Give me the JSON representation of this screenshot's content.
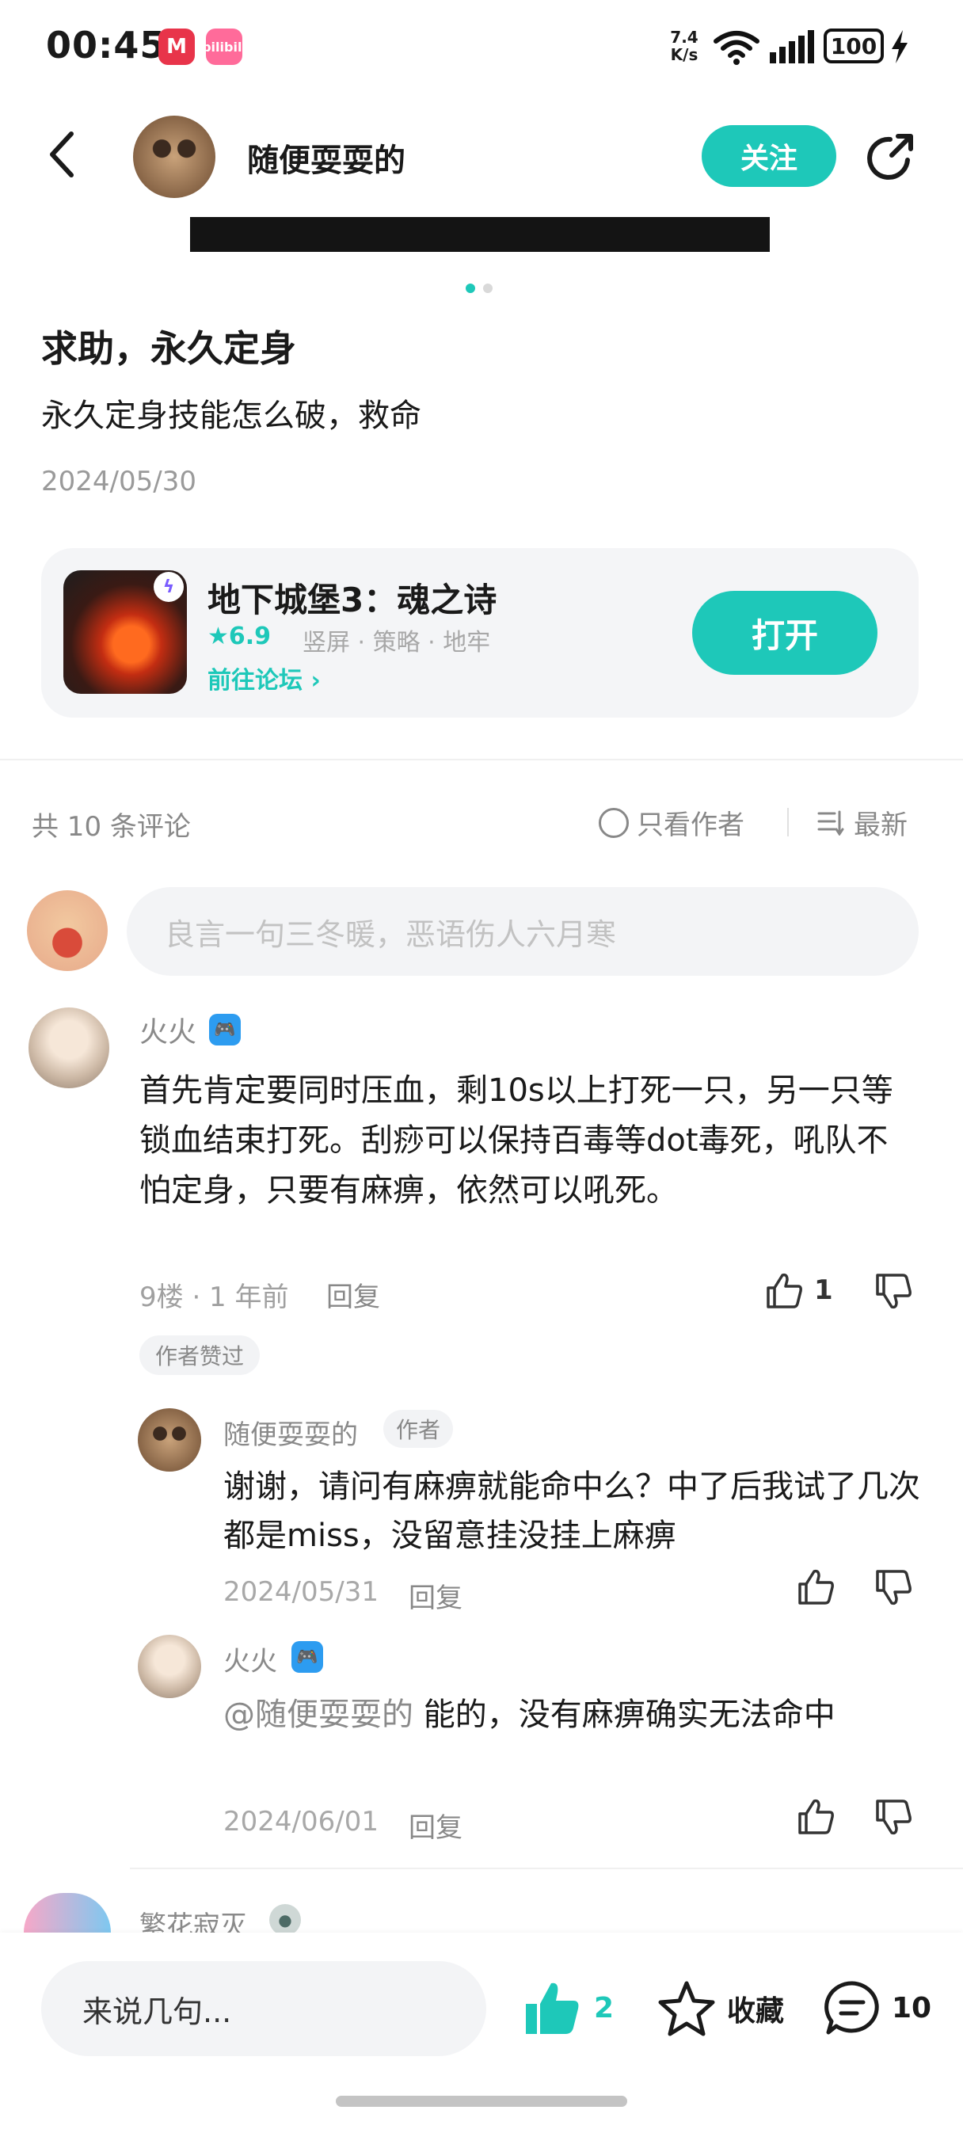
{
  "status_bar": {
    "time": "00:45",
    "app_icon_1": "M",
    "app_icon_2": "bilibili",
    "net_speed_value": "7.4",
    "net_speed_unit": "K/s",
    "battery": "100"
  },
  "header": {
    "username": "随便耍耍的",
    "follow_label": "关注"
  },
  "post": {
    "title": "求助，永久定身",
    "body": "永久定身技能怎么破，救命",
    "date": "2024/05/30"
  },
  "game_card": {
    "name": "地下城堡3：魂之诗",
    "rating": "★6.9",
    "tags": "竖屏 · 策略 · 地牢",
    "forum_link": "前往论坛 ›",
    "open_label": "打开"
  },
  "comments_header": {
    "count": "共 10 条评论",
    "author_only": "只看作者",
    "sort": "最新"
  },
  "reply_input": {
    "placeholder": "良言一句三冬暖，恶语伤人六月寒"
  },
  "comments": [
    {
      "user": "火火",
      "text": "首先肯定要同时压血，剩10s以上打死一只，另一只等锁血结束打死。刮痧可以保持百毒等dot毒死，吼队不怕定身，只要有麻痹，依然可以吼死。",
      "meta": "9楼 · 1 年前",
      "reply_label": "回复",
      "likes": "1",
      "author_liked": "作者赞过",
      "replies": [
        {
          "user": "随便耍耍的",
          "tag": "作者",
          "text": "谢谢，请问有麻痹就能命中么？中了后我试了几次都是miss，没留意挂没挂上麻痹",
          "date": "2024/05/31",
          "reply_label": "回复"
        },
        {
          "user": "火火",
          "mention": "@随便耍耍的",
          "text": " 能的，没有麻痹确实无法命中",
          "date": "2024/06/01",
          "reply_label": "回复"
        }
      ]
    },
    {
      "user": "繁花寂灭"
    }
  ],
  "bottom_bar": {
    "input_label": "来说几句...",
    "like_count": "2",
    "favorite_label": "收藏",
    "comment_count": "10"
  },
  "colors": {
    "accent": "#1ec8b9",
    "muted_text": "#8a8a8a",
    "input_bg": "#f3f4f6"
  }
}
